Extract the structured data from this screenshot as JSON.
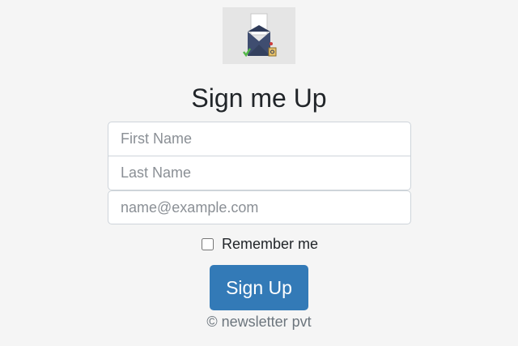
{
  "logo": {
    "icon": "envelope-letter-icon"
  },
  "heading": "Sign me Up",
  "form": {
    "first_name_placeholder": "First Name",
    "last_name_placeholder": "Last Name",
    "email_placeholder": "name@example.com",
    "remember_label": "Remember me",
    "remember_checked": false,
    "submit_label": "Sign Up"
  },
  "footer": "© newsletter pvt",
  "colors": {
    "background": "#f5f5f5",
    "button": "#337ab7",
    "button_text": "#ffffff"
  }
}
